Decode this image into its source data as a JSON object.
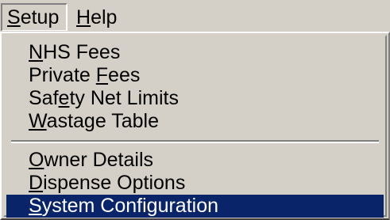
{
  "menubar": {
    "items": [
      {
        "pre": "",
        "mn": "S",
        "post": "etup"
      },
      {
        "pre": "",
        "mn": "H",
        "post": "elp"
      }
    ]
  },
  "dropdown": {
    "items": [
      {
        "pre": "",
        "mn": "N",
        "post": "HS Fees"
      },
      {
        "pre": "Private ",
        "mn": "F",
        "post": "ees"
      },
      {
        "pre": "Saf",
        "mn": "e",
        "post": "ty Net Limits"
      },
      {
        "pre": "",
        "mn": "W",
        "post": "astage Table"
      },
      {
        "pre": "",
        "mn": "O",
        "post": "wner Details"
      },
      {
        "pre": "",
        "mn": "D",
        "post": "ispense Options"
      },
      {
        "pre": "",
        "mn": "S",
        "post": "ystem Configuration"
      }
    ],
    "selected_index": 6
  },
  "colors": {
    "face": "#d4d0c8",
    "highlight": "#0a246a",
    "highlight_text": "#ffffff"
  }
}
